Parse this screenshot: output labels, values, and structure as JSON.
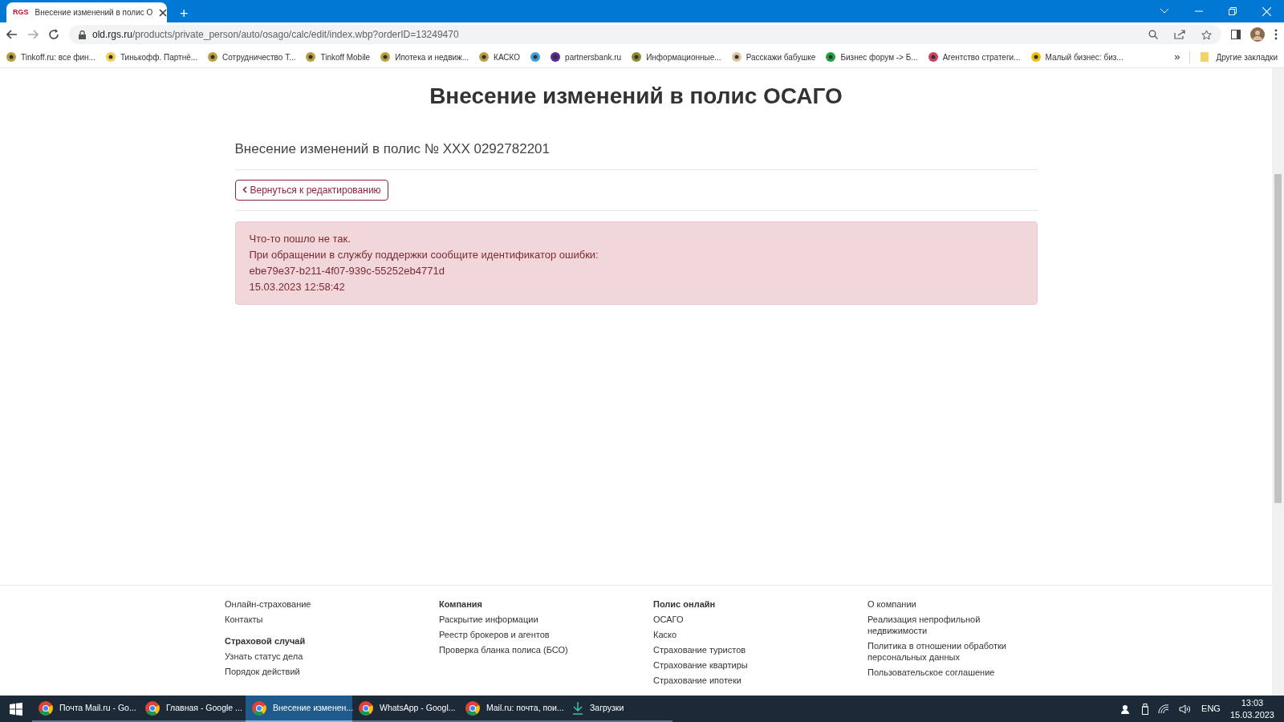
{
  "browser": {
    "tabs": [
      {
        "favicon": "RGS",
        "title": "Внесение изменений в полис О",
        "selected": true
      }
    ],
    "new_tab": "+",
    "url": {
      "host": "old.rgs.ru",
      "path": "/products/private_person/auto/osago/calc/edit/index.wbp?orderID=13249470"
    },
    "bookmarks": [
      {
        "label": "Tinkoff.ru: все фин...",
        "color": "#b8a040"
      },
      {
        "label": "Тинькофф. Партнё...",
        "color": "#f0d050"
      },
      {
        "label": "Сотрудничество Т...",
        "color": "#b8a040"
      },
      {
        "label": "Tinkoff Mobile",
        "color": "#b8a040"
      },
      {
        "label": "Ипотека и недвиж...",
        "color": "#b8a040"
      },
      {
        "label": "КАСКО",
        "color": "#b8a040"
      },
      {
        "color": "#3aa0e0"
      },
      {
        "label": "partnersbank.ru",
        "color": "#5a2a9a"
      },
      {
        "label": "Информационные...",
        "color": "#8a8a30"
      },
      {
        "label": "Расскажи бабушке",
        "color": "#d8c8a0"
      },
      {
        "label": "Бизнес форум -> Б...",
        "color": "#20a040"
      },
      {
        "label": "Агентство стратеги...",
        "color": "#d04060"
      },
      {
        "label": "Малый бизнес: биз...",
        "color": "#f0c000"
      }
    ],
    "more": "»",
    "other_bookmarks": "Другие закладки"
  },
  "page": {
    "title": "Внесение изменений в полис ОСАГО",
    "subtitle": "Внесение изменений в полис № XXX 0292782201",
    "back_button": "Вернуться к редактированию",
    "error_lines": [
      "Что-то пошло не так.",
      "При обращении в службу поддержки сообщите идентификатор ошибки:",
      "ebe79e37-b211-4f07-939c-55252eb4771d",
      "15.03.2023 12:58:42"
    ]
  },
  "footer": {
    "columns": [
      {
        "items": [
          {
            "label": "Онлайн-страхование",
            "heading": false
          },
          {
            "label": "Контакты",
            "heading": false
          },
          {
            "label": "Страховой случай",
            "heading": true
          },
          {
            "label": "Узнать статус дела",
            "heading": false
          },
          {
            "label": "Порядок действий",
            "heading": false
          }
        ]
      },
      {
        "items": [
          {
            "label": "Компания",
            "heading": true
          },
          {
            "label": "Раскрытие информации",
            "heading": false
          },
          {
            "label": "Реестр брокеров и агентов",
            "heading": false
          },
          {
            "label": "Проверка бланка полиса (БСО)",
            "heading": false
          }
        ]
      },
      {
        "items": [
          {
            "label": "Полис онлайн",
            "heading": true
          },
          {
            "label": "ОСАГО",
            "heading": false
          },
          {
            "label": "Каско",
            "heading": false
          },
          {
            "label": "Страхование туристов",
            "heading": false
          },
          {
            "label": "Страхование квартиры",
            "heading": false
          },
          {
            "label": "Страхование ипотеки",
            "heading": false
          }
        ]
      },
      {
        "items": [
          {
            "label": "О компании",
            "heading": false
          },
          {
            "label": "Реализация непрофильной недвижимости",
            "heading": false
          },
          {
            "label": "Политика в отношении обработки персональных данных",
            "heading": false
          },
          {
            "label": "Пользовательское соглашение",
            "heading": false
          }
        ]
      }
    ]
  },
  "taskbar": {
    "apps": [
      {
        "label": "Почта Mail.ru - Go...",
        "kind": "browser",
        "selected": false
      },
      {
        "label": "Главная - Google ...",
        "kind": "browser",
        "selected": false
      },
      {
        "label": "Внесение изменен...",
        "kind": "browser",
        "selected": true
      },
      {
        "label": "WhatsApp - Googl...",
        "kind": "browser",
        "selected": false
      },
      {
        "label": "Mail.ru: почта, пои...",
        "kind": "browser",
        "selected": false
      },
      {
        "label": "Загрузки",
        "kind": "download",
        "selected": false
      }
    ],
    "language": "ENG",
    "time": "13:03",
    "date": "15.03.2023"
  }
}
